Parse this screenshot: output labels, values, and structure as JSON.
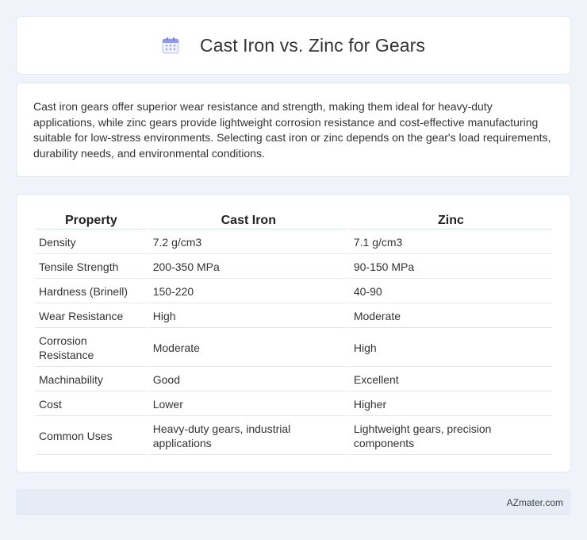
{
  "header": {
    "icon": "calendar-icon",
    "title": "Cast Iron vs. Zinc for Gears"
  },
  "description": "Cast iron gears offer superior wear resistance and strength, making them ideal for heavy-duty applications, while zinc gears provide lightweight corrosion resistance and cost-effective manufacturing suitable for low-stress environments. Selecting cast iron or zinc depends on the gear's load requirements, durability needs, and environmental conditions.",
  "table": {
    "headers": [
      "Property",
      "Cast Iron",
      "Zinc"
    ],
    "rows": [
      [
        "Density",
        "7.2 g/cm3",
        "7.1 g/cm3"
      ],
      [
        "Tensile Strength",
        "200-350 MPa",
        "90-150 MPa"
      ],
      [
        "Hardness (Brinell)",
        "150-220",
        "40-90"
      ],
      [
        "Wear Resistance",
        "High",
        "Moderate"
      ],
      [
        "Corrosion Resistance",
        "Moderate",
        "High"
      ],
      [
        "Machinability",
        "Good",
        "Excellent"
      ],
      [
        "Cost",
        "Lower",
        "Higher"
      ],
      [
        "Common Uses",
        "Heavy-duty gears, industrial applications",
        "Lightweight gears, precision components"
      ]
    ]
  },
  "footer": {
    "site": "AZmater.com"
  },
  "colors": {
    "background": "#f0f3f9",
    "card": "#ffffff",
    "footer_bg": "#e6ecf6"
  }
}
